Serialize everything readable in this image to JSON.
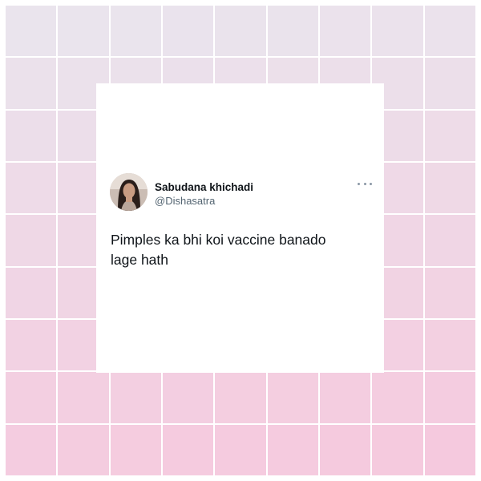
{
  "tweet": {
    "display_name": "Sabudana khichadi",
    "handle": "@Dishasatra",
    "text_lines": [
      "Pimples ka bhi koi vaccine banado",
      "lage hath"
    ]
  },
  "background": {
    "grid_color": "#ffffff",
    "gradient_top": "#e9e6ee",
    "gradient_bottom": "#f7c6dc"
  },
  "icons": {
    "more": "more-horizontal-icon",
    "avatar": "profile-photo"
  }
}
